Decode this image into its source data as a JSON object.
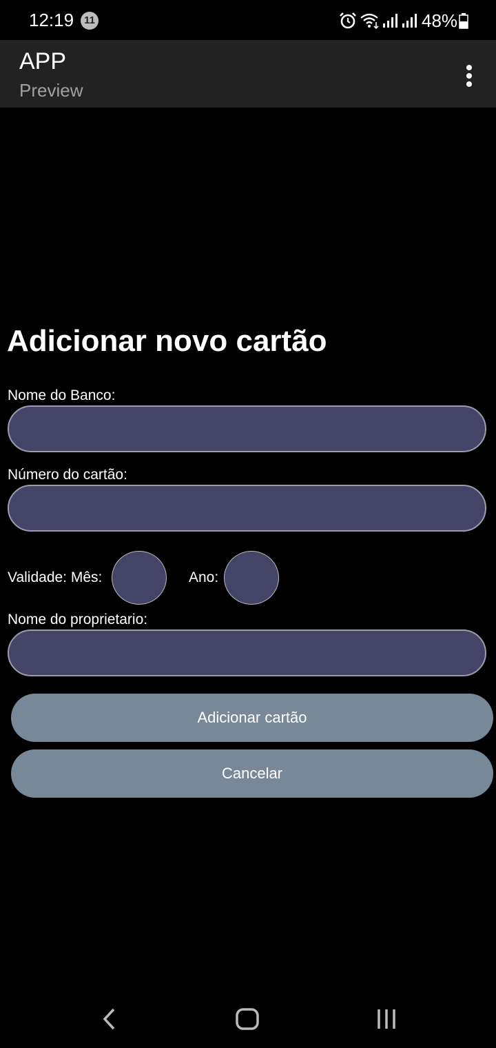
{
  "status_bar": {
    "time": "12:19",
    "notification_count": "11",
    "battery": "48%",
    "icons": [
      "alarm-icon",
      "wifi-icon",
      "signal-icon",
      "signal-icon",
      "battery-icon"
    ]
  },
  "app_bar": {
    "title": "APP",
    "subtitle": "Preview",
    "overflow_icon": "more-vert-icon"
  },
  "form": {
    "title": "Adicionar novo cartão",
    "bank_label": "Nome do Banco:",
    "bank_value": "",
    "card_number_label": "Número do cartão:",
    "card_number_value": "",
    "expiry_month_label": "Validade: Mês:",
    "expiry_month_value": "",
    "expiry_year_label": "Ano:",
    "expiry_year_value": "",
    "owner_label": "Nome do proprietario:",
    "owner_value": ""
  },
  "buttons": {
    "add_label": "Adicionar cartão",
    "cancel_label": "Cancelar"
  },
  "nav_bar": {
    "icons": [
      "back-icon",
      "home-icon",
      "recents-icon"
    ]
  },
  "colors": {
    "background": "#000000",
    "app_bar": "#222222",
    "input_fill": "#444466",
    "input_border": "#9c9cb0",
    "button_fill": "#778899"
  }
}
